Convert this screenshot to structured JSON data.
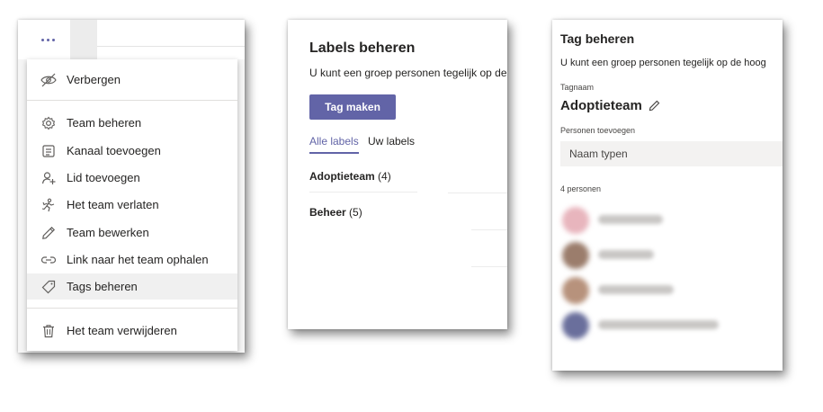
{
  "menu": {
    "more_button_icon": "more-options-icon",
    "items": [
      {
        "label": "Verbergen",
        "icon": "hide-icon"
      },
      {
        "label": "Team beheren",
        "icon": "gear-icon"
      },
      {
        "label": "Kanaal toevoegen",
        "icon": "add-channel-icon"
      },
      {
        "label": "Lid toevoegen",
        "icon": "add-member-icon"
      },
      {
        "label": "Het team verlaten",
        "icon": "leave-team-icon"
      },
      {
        "label": "Team bewerken",
        "icon": "pencil-icon"
      },
      {
        "label": "Link naar het team ophalen",
        "icon": "link-icon"
      },
      {
        "label": "Tags beheren",
        "icon": "tag-icon",
        "active": true
      },
      {
        "label": "Het team verwijderen",
        "icon": "trash-icon"
      }
    ]
  },
  "labels_panel": {
    "title": "Labels beheren",
    "description": "U kunt een groep personen tegelijk op de",
    "create_button": "Tag maken",
    "tabs": [
      "Alle labels",
      "Uw labels"
    ],
    "labels": [
      {
        "name": "Adoptieteam",
        "count": "(4)"
      },
      {
        "name": "Beheer",
        "count": "(5)"
      }
    ]
  },
  "tag_panel": {
    "title": "Tag beheren",
    "description": "U kunt een groep personen tegelijk op de hoog",
    "tagname_label": "Tagnaam",
    "tagname": "Adoptieteam",
    "add_people_label": "Personen toevoegen",
    "input_placeholder": "Naam typen",
    "people_count": "4 personen"
  },
  "colors": {
    "accent": "#6264a7"
  }
}
